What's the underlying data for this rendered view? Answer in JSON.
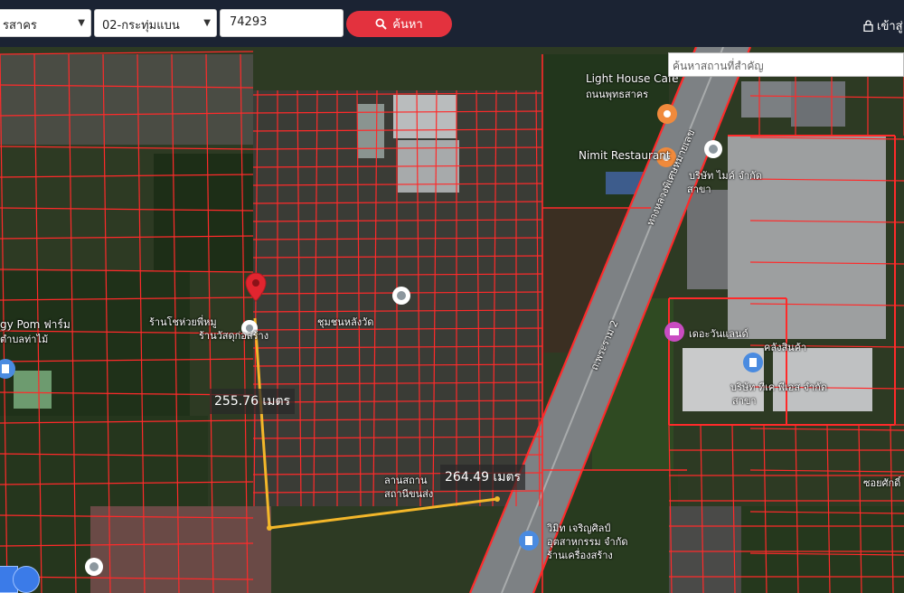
{
  "topbar": {
    "province_value": "รสาคร",
    "zone_value": "02-กระทุ่มแบน",
    "parcel_value": "74293",
    "search_label": "ค้นหา",
    "login_label": "เข้าสู่"
  },
  "map": {
    "place_search_placeholder": "ค้นหาสถานที่สำคัญ",
    "measurements": [
      "255.76 เมตร",
      "264.49 เมตร"
    ],
    "labels": {
      "lighthouse": "Light House Cafe",
      "lighthouse_road": "ถนนพุทธสาคร",
      "nimit": "Nimit Restaurant",
      "pom_farm": "gy Pom ฟาร์ม",
      "pom_farm_sub": "ตำบลท่าไม้",
      "shop": "ร้านโชห่วยพี่หมู",
      "shop_sub": "ร้านวัสดุก่อสร้าง",
      "ward": "ชุมชนหลังวัด",
      "highway": "ทางหลวงพิเศษหมายเลข",
      "highway2": "ถ.พระราม 2",
      "warehouse": "เดอะวันแลนด์",
      "warehouse_sub": "คลังสินค้า",
      "company": "บริษัท ทีเค พีเอส จำกัด",
      "company_sub": "สาขา",
      "company2": "บริษัท ไมค์ จำกัด",
      "company2_sub": "สาขา",
      "corner_road": "ซอยศักดิ์",
      "vimit": "วิมิท เจริญศิลป์",
      "vimit_sub": "อุตสาหกรรม จำกัด",
      "vimit_sub2": "ร้านเครื่องสร้าง",
      "yard": "ลานสถาน",
      "yard_sub": "สถานีขนส่ง"
    }
  },
  "colors": {
    "topbar": "#1b2333",
    "search_button": "#e3323e",
    "parcel_lines": "#ff2a2a",
    "measure_line": "#f3b72a",
    "pin": "#e1252f"
  }
}
